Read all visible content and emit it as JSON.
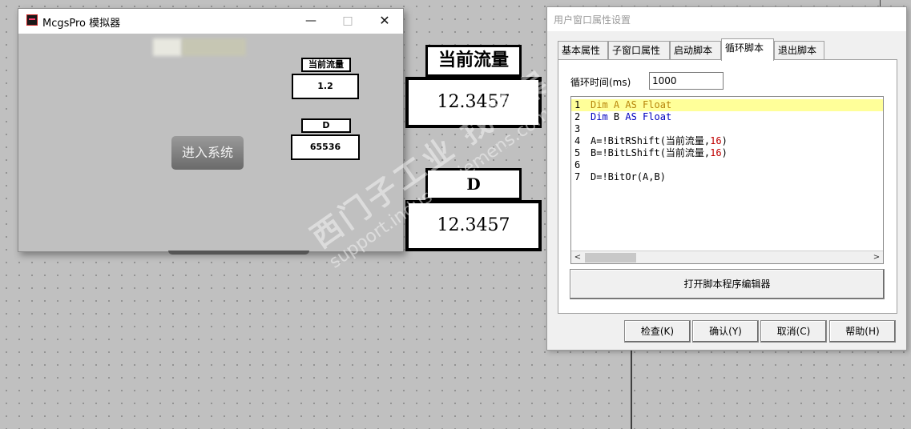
{
  "simulator": {
    "title": "McgsPro 模拟器",
    "enter_button": "进入系统",
    "flow_label": "当前流量",
    "flow_value": "1.2",
    "d_label": "D",
    "d_value": "65536"
  },
  "canvas": {
    "flow_label": "当前流量",
    "flow_value": "12.3457",
    "d_label": "D",
    "d_value": "12.3457"
  },
  "watermark": {
    "line1": "西门子工业 找答案",
    "line2": "support.industry.siemens.com/cs"
  },
  "dialog": {
    "title": "用户窗口属性设置",
    "tabs": [
      "基本属性",
      "子窗口属性",
      "启动脚本",
      "循环脚本",
      "退出脚本"
    ],
    "active_tab": "循环脚本",
    "cycle_time_label": "循环时间(ms)",
    "cycle_time_value": "1000",
    "script_lines": [
      {
        "n": "1",
        "parts": [
          "Dim ",
          "A ",
          "AS ",
          "Float"
        ]
      },
      {
        "n": "2",
        "parts": [
          "Dim ",
          "B ",
          "AS ",
          "Float"
        ]
      },
      {
        "n": "3",
        "text": ""
      },
      {
        "n": "4",
        "prefix": "A=!BitRShift(当前流量,",
        "num": "16",
        "suffix": ")"
      },
      {
        "n": "5",
        "prefix": "B=!BitLShift(当前流量,",
        "num": "16",
        "suffix": ")"
      },
      {
        "n": "6",
        "text": ""
      },
      {
        "n": "7",
        "text": "D=!BitOr(A,B)"
      }
    ],
    "open_editor_button": "打开脚本程序编辑器",
    "buttons": {
      "check": "检查(K)",
      "confirm": "确认(Y)",
      "cancel": "取消(C)",
      "help": "帮助(H)"
    }
  },
  "colors": {
    "canvas_bg": "#c0c0c0",
    "highlight_line": "#ffff99",
    "keyword": "#0000c0",
    "number": "#c00000"
  }
}
